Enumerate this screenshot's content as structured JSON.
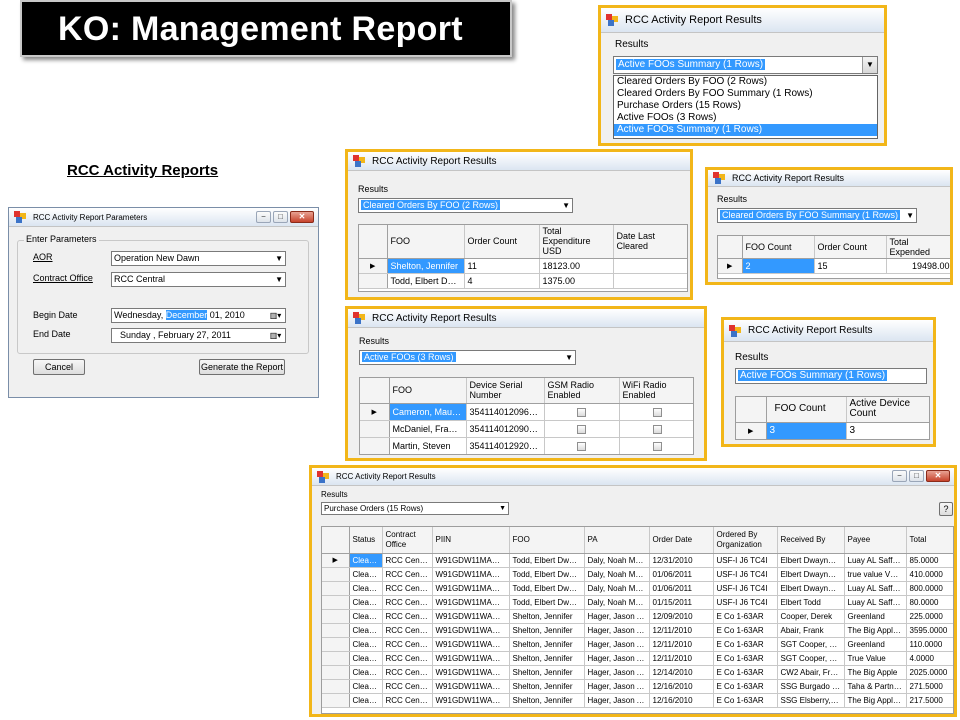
{
  "slide": {
    "title": "KO: Management Report",
    "section_heading": "RCC Activity Reports"
  },
  "window_title": "RCC Activity Report Results",
  "results_label": "Results",
  "dropdown_window": {
    "selected": "Active FOOs Summary (1 Rows)",
    "options": [
      "Cleared Orders By FOO (2 Rows)",
      "Cleared Orders By FOO Summary (1 Rows)",
      "Purchase Orders (15 Rows)",
      "Active FOOs (3 Rows)",
      "Active FOOs Summary (1 Rows)"
    ]
  },
  "params_window": {
    "title": "RCC Activity Report Parameters",
    "group_label": "Enter Parameters",
    "aor_label": "AOR",
    "aor_value": "Operation New Dawn",
    "contract_label": "Contract Office",
    "contract_value": "RCC Central",
    "begin_label": "Begin Date",
    "begin_parts": [
      "Wednesday, ",
      "December",
      " 01, 2010"
    ],
    "end_label": "End Date",
    "end_value": "Sunday   ,  February  27, 2011",
    "cancel_label": "Cancel",
    "generate_label": "Generate the Report"
  },
  "cleared_by_foo": {
    "selected": "Cleared Orders By FOO (2 Rows)",
    "columns": [
      "FOO",
      "Order Count",
      "Total Expenditure USD",
      "Date Last Cleared"
    ],
    "rows": [
      [
        "Shelton, Jennifer",
        "11",
        "18123.00",
        ""
      ],
      [
        "Todd, Elbert Dwa...",
        "4",
        "1375.00",
        ""
      ]
    ]
  },
  "cleared_summary": {
    "selected": "Cleared Orders By FOO Summary (1 Rows)",
    "columns": [
      "FOO Count",
      "Order Count",
      "Total Expended"
    ],
    "rows": [
      [
        "2",
        "15",
        "19498.00"
      ]
    ]
  },
  "active_foos": {
    "selected": "Active FOOs (3 Rows)",
    "columns": [
      "FOO",
      "Device Serial Number",
      "GSM Radio Enabled",
      "WiFi Radio Enabled"
    ],
    "rows": [
      [
        "Cameron, Maure...",
        "354114012096906"
      ],
      [
        "McDaniel, Franc...",
        "354114012090941"
      ],
      [
        "Martin, Steven",
        "354114012920329"
      ]
    ]
  },
  "active_summary": {
    "selected": "Active FOOs Summary (1 Rows)",
    "columns": [
      "FOO Count",
      "Active Device Count"
    ],
    "rows": [
      [
        "3",
        "3"
      ]
    ]
  },
  "purchase_orders": {
    "selected": "Purchase Orders (15 Rows)",
    "help_label": "?",
    "columns": [
      "Status",
      "Contract Office",
      "PIIN",
      "FOO",
      "PA",
      "Order Date",
      "Ordered By Organization",
      "Received By",
      "Payee",
      "Total"
    ],
    "rows": [
      [
        "Cleared",
        "RCC Central",
        "W91GDW11MAC01",
        "Todd, Elbert Dwayne",
        "Daly, Noah Matth...",
        "12/31/2010",
        "USF-I J6 TC4I",
        "Elbert Dwayne T...",
        "Luay AL Saffar a...",
        "85.0000"
      ],
      [
        "Cleared",
        "RCC Central",
        "W91GDW11MAC02",
        "Todd, Elbert Dwayne",
        "Daly, Noah Matth...",
        "01/06/2011",
        "USF-I J6 TC4I",
        "Elbert Dwayne T...",
        "true value Vbc A...",
        "410.0000"
      ],
      [
        "Cleared",
        "RCC Central",
        "W91GDW11MAC03",
        "Todd, Elbert Dwayne",
        "Daly, Noah Matth...",
        "01/06/2011",
        "USF-I J6 TC4I",
        "Elbert Dwayne T...",
        "Luay AL Saffar a...",
        "800.0000"
      ],
      [
        "Cleared",
        "RCC Central",
        "W91GDW11MAC04",
        "Todd, Elbert Dwayne",
        "Daly, Noah Matth...",
        "01/15/2011",
        "USF-I J6 TC4I",
        "Elbert Todd",
        "Luay AL Saffar a...",
        "80.0000"
      ],
      [
        "Cleared",
        "RCC Central",
        "W91GDW11WAG01",
        "Shelton, Jennifer",
        "Hager, Jason An...",
        "12/09/2010",
        "E Co 1-63AR",
        "Cooper, Derek",
        "Greenland",
        "225.0000"
      ],
      [
        "Cleared",
        "RCC Central",
        "W91GDW11WAG02",
        "Shelton, Jennifer",
        "Hager, Jason An...",
        "12/11/2010",
        "E Co 1-63AR",
        "Abair, Frank",
        "The Big Apple St...",
        "3595.0000"
      ],
      [
        "Cleared",
        "RCC Central",
        "W91GDW11WAG03",
        "Shelton, Jennifer",
        "Hager, Jason An...",
        "12/11/2010",
        "E Co 1-63AR",
        "SGT Cooper, Der...",
        "Greenland",
        "110.0000"
      ],
      [
        "Cleared",
        "RCC Central",
        "W91GDW11WAG04",
        "Shelton, Jennifer",
        "Hager, Jason An...",
        "12/11/2010",
        "E Co 1-63AR",
        "SGT Cooper, Der...",
        "True Value",
        "4.0000"
      ],
      [
        "Cleared",
        "RCC Central",
        "W91GDW11WAG05",
        "Shelton, Jennifer",
        "Hager, Jason An...",
        "12/14/2010",
        "E Co 1-63AR",
        "CW2 Abair, Frank",
        "The Big Apple",
        "2025.0000"
      ],
      [
        "Cleared",
        "RCC Central",
        "W91GDW11WAG06",
        "Shelton, Jennifer",
        "Hager, Jason An...",
        "12/16/2010",
        "E Co 1-63AR",
        "SSG Burgado Jr.,...",
        "Taha & Partners ...",
        "271.5000"
      ],
      [
        "Cleared",
        "RCC Central",
        "W91GDW11WAG07",
        "Shelton, Jennifer",
        "Hager, Jason An...",
        "12/16/2010",
        "E Co 1-63AR",
        "SSG Elsberry, Re...",
        "The Big Apple St...",
        "217.5000"
      ]
    ]
  },
  "icons": {
    "row_pointer": "row-pointer-icon",
    "dropdown_arrow": "chevron-down-icon",
    "calendar": "calendar-icon"
  },
  "colors": {
    "frame_border": "#f2b619",
    "selection": "#3399ff",
    "banner": "#000000"
  }
}
